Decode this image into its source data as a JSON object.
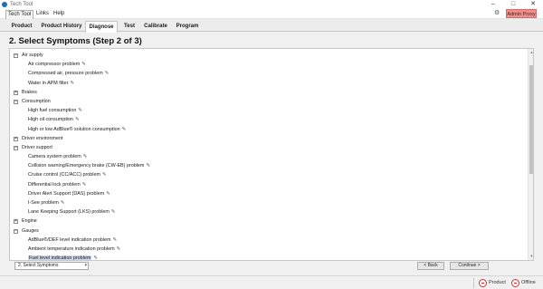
{
  "app": {
    "title": "Tech Tool"
  },
  "menu": {
    "items": [
      "Tech Tool",
      "Links",
      "Help"
    ]
  },
  "toolbar": {
    "admin_label": "Admin Proxy"
  },
  "tabs": [
    "Product",
    "Product History",
    "Diagnose",
    "Test",
    "Calibrate",
    "Program"
  ],
  "active_tab": "Diagnose",
  "page": {
    "heading": "2. Select Symptoms (Step 2 of 3)"
  },
  "tree": {
    "rows": [
      {
        "type": "cat",
        "label": "Air supply",
        "expanded": true
      },
      {
        "type": "item",
        "label": "Air compressor problem"
      },
      {
        "type": "item",
        "label": "Compressed air, pressure problem"
      },
      {
        "type": "item",
        "label": "Water in APM filter"
      },
      {
        "type": "cat",
        "label": "Brakes",
        "expanded": false
      },
      {
        "type": "cat",
        "label": "Consumption",
        "expanded": true
      },
      {
        "type": "item",
        "label": "High fuel consumption"
      },
      {
        "type": "item",
        "label": "High oil consumption"
      },
      {
        "type": "item",
        "label": "High or low AdBlue® solution consumption"
      },
      {
        "type": "cat",
        "label": "Driver environment",
        "expanded": false
      },
      {
        "type": "cat",
        "label": "Driver support",
        "expanded": true
      },
      {
        "type": "item",
        "label": "Camera system problem"
      },
      {
        "type": "item",
        "label": "Collision warning/Emergency brake (CW-EB) problem"
      },
      {
        "type": "item",
        "label": "Cruise control (CC/ACC) problem"
      },
      {
        "type": "item",
        "label": "Differential lock problem"
      },
      {
        "type": "item",
        "label": "Driver Alert Support (DAS) problem"
      },
      {
        "type": "item",
        "label": "I-See problem"
      },
      {
        "type": "item",
        "label": "Lane Keeping Support (LKS) problem"
      },
      {
        "type": "cat",
        "label": "Engine",
        "expanded": false
      },
      {
        "type": "cat",
        "label": "Gauges",
        "expanded": true
      },
      {
        "type": "item",
        "label": "AdBlue®/DEF level indication problem"
      },
      {
        "type": "item",
        "label": "Ambient temperature indication problem"
      },
      {
        "type": "item",
        "label": "Fuel level indication problem",
        "selected": true
      }
    ]
  },
  "footer": {
    "step_select_value": "2. Select Symptoms",
    "back_label": "< Back",
    "continue_label": "Continue >"
  },
  "status": {
    "product_label": "Product",
    "offline_label": "Offline"
  }
}
